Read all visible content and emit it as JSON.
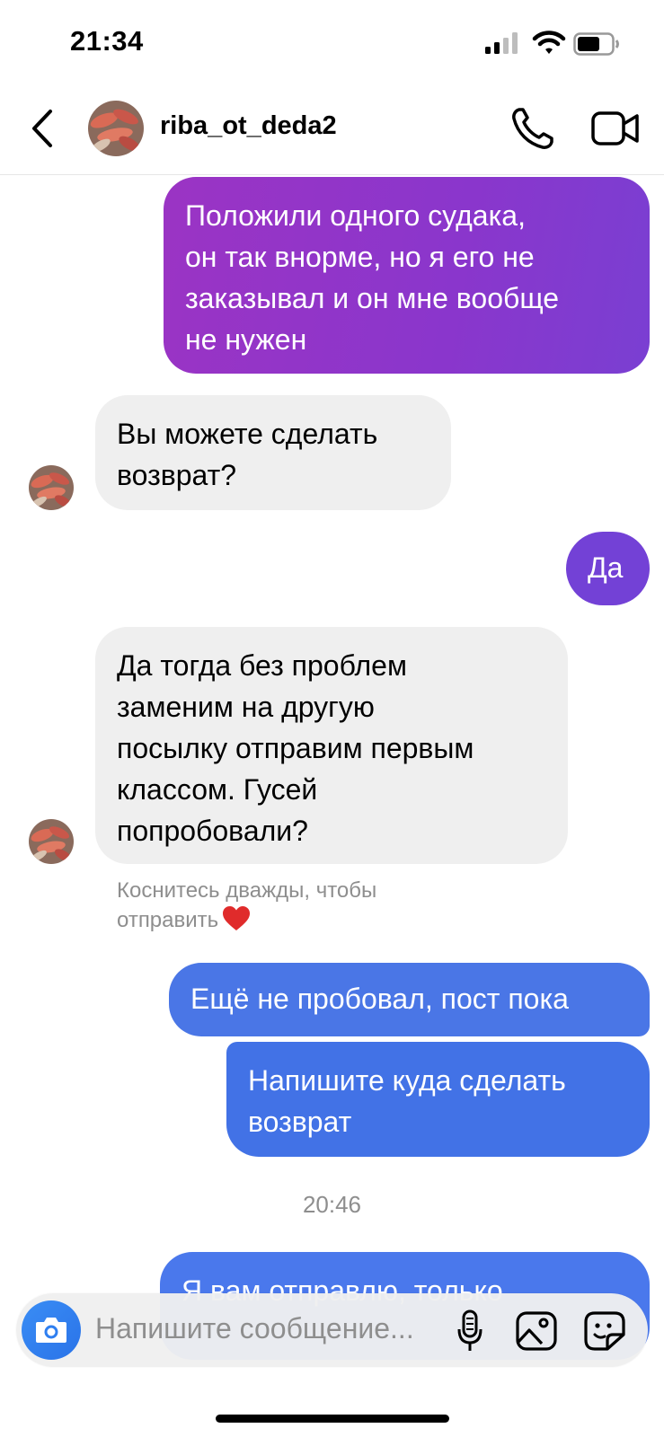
{
  "status_bar": {
    "time": "21:34"
  },
  "header": {
    "username": "riba_ot_deda2"
  },
  "messages": [
    {
      "direction": "out",
      "text": "Положили одного судака,\nон так внорме, но я его не\nзаказывал и он мне вообще\nне нужен"
    },
    {
      "direction": "in",
      "text": "Вы можете сделать\nвозврат?"
    },
    {
      "direction": "out",
      "text": "Да"
    },
    {
      "direction": "in",
      "text": "Да тогда без проблем\nзаменим на другую\nпосылку отправим первым\nклассом. Гусей\nпопробовали?"
    },
    {
      "direction": "out",
      "text": "Ещё не пробовал, пост пока"
    },
    {
      "direction": "out",
      "text": "Напишите куда сделать\nвозврат"
    },
    {
      "direction": "out",
      "text": "Я вам отправлю, только"
    }
  ],
  "double_tap_hint": "Коснитесь дважды, чтобы\nотправить",
  "timestamp": "20:46",
  "composer": {
    "placeholder": "Напишите сообщение..."
  },
  "colors": {
    "outgoing_purple": "#9b34c4",
    "outgoing_blue": "#4a76e6",
    "incoming": "#efefef",
    "heart": "#e02b2b"
  }
}
